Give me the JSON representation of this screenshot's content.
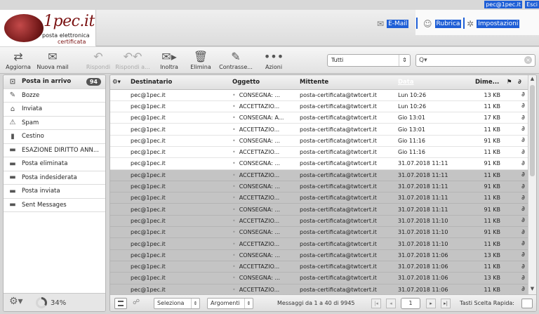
{
  "topbar": {
    "user": "pec@1pec.it",
    "logout": "Esci"
  },
  "brand": {
    "name": "1pec.it",
    "tagline1": "posta elettronica",
    "tagline2": "certificata"
  },
  "nav": {
    "mail": "E-Mail",
    "rubrica": "Rubrica",
    "settings": "Impostazioni"
  },
  "toolbar": {
    "refresh": "Aggiorna",
    "new_mail": "Nuova mail",
    "reply": "Rispondi",
    "reply_all": "Rispondi a...",
    "forward": "Inoltra",
    "delete": "Elimina",
    "mark": "Contrasse...",
    "actions": "Azioni",
    "filter_value": "Tutti",
    "search_placeholder": "Q▾"
  },
  "sidebar": {
    "items": [
      {
        "label": "Posta in arrivo",
        "icon": "inbox-icon",
        "count": "94",
        "active": true
      },
      {
        "label": "Bozze",
        "icon": "pencil-icon"
      },
      {
        "label": "Inviata",
        "icon": "sent-icon"
      },
      {
        "label": "Spam",
        "icon": "spam-icon"
      },
      {
        "label": "Cestino",
        "icon": "trash-icon"
      },
      {
        "label": "ESAZIONE DIRITTO ANN...",
        "icon": "folder-icon"
      },
      {
        "label": "Posta eliminata",
        "icon": "folder-icon"
      },
      {
        "label": "Posta indesiderata",
        "icon": "folder-icon"
      },
      {
        "label": "Posta inviata",
        "icon": "folder-icon"
      },
      {
        "label": "Sent Messages",
        "icon": "folder-icon"
      }
    ],
    "quota": "34%",
    "quota_value": 34
  },
  "list": {
    "headers": {
      "to": "Destinatario",
      "subject": "Oggetto",
      "from": "Mittente",
      "date": "Data",
      "size": "Dime..."
    },
    "rows": [
      {
        "to": "pec@1pec.it",
        "subject": "CONSEGNA: ...",
        "from": "posta-certificata@twtcert.it",
        "date": "Lun 10:26",
        "size": "13 KB",
        "selected": false
      },
      {
        "to": "pec@1pec.it",
        "subject": "ACCETTAZIO...",
        "from": "posta-certificata@twtcert.it",
        "date": "Lun 10:26",
        "size": "11 KB",
        "selected": false
      },
      {
        "to": "pec@1pec.it",
        "subject": "CONSEGNA: A...",
        "from": "posta-certificata@twtcert.it",
        "date": "Gio 13:01",
        "size": "17 KB",
        "selected": false
      },
      {
        "to": "pec@1pec.it",
        "subject": "ACCETTAZIO...",
        "from": "posta-certificata@twtcert.it",
        "date": "Gio 13:01",
        "size": "11 KB",
        "selected": false
      },
      {
        "to": "pec@1pec.it",
        "subject": "CONSEGNA: ...",
        "from": "posta-certificata@twtcert.it",
        "date": "Gio 11:16",
        "size": "91 KB",
        "selected": false
      },
      {
        "to": "pec@1pec.it",
        "subject": "ACCETTAZIO...",
        "from": "posta-certificata@twtcert.it",
        "date": "Gio 11:16",
        "size": "11 KB",
        "selected": false
      },
      {
        "to": "pec@1pec.it",
        "subject": "CONSEGNA: ...",
        "from": "posta-certificata@twtcert.it",
        "date": "31.07.2018 11:11",
        "size": "91 KB",
        "selected": false
      },
      {
        "to": "pec@1pec.it",
        "subject": "ACCETTAZIO...",
        "from": "posta-certificata@twtcert.it",
        "date": "31.07.2018 11:11",
        "size": "11 KB",
        "selected": true
      },
      {
        "to": "pec@1pec.it",
        "subject": "CONSEGNA: ...",
        "from": "posta-certificata@twtcert.it",
        "date": "31.07.2018 11:11",
        "size": "91 KB",
        "selected": true
      },
      {
        "to": "pec@1pec.it",
        "subject": "ACCETTAZIO...",
        "from": "posta-certificata@twtcert.it",
        "date": "31.07.2018 11:11",
        "size": "11 KB",
        "selected": true
      },
      {
        "to": "pec@1pec.it",
        "subject": "CONSEGNA: ...",
        "from": "posta-certificata@twtcert.it",
        "date": "31.07.2018 11:11",
        "size": "91 KB",
        "selected": true
      },
      {
        "to": "pec@1pec.it",
        "subject": "ACCETTAZIO...",
        "from": "posta-certificata@twtcert.it",
        "date": "31.07.2018 11:10",
        "size": "11 KB",
        "selected": true
      },
      {
        "to": "pec@1pec.it",
        "subject": "CONSEGNA: ...",
        "from": "posta-certificata@twtcert.it",
        "date": "31.07.2018 11:10",
        "size": "91 KB",
        "selected": true
      },
      {
        "to": "pec@1pec.it",
        "subject": "ACCETTAZIO...",
        "from": "posta-certificata@twtcert.it",
        "date": "31.07.2018 11:10",
        "size": "11 KB",
        "selected": true
      },
      {
        "to": "pec@1pec.it",
        "subject": "CONSEGNA: ...",
        "from": "posta-certificata@twtcert.it",
        "date": "31.07.2018 11:06",
        "size": "13 KB",
        "selected": true
      },
      {
        "to": "pec@1pec.it",
        "subject": "ACCETTAZIO...",
        "from": "posta-certificata@twtcert.it",
        "date": "31.07.2018 11:06",
        "size": "11 KB",
        "selected": true
      },
      {
        "to": "pec@1pec.it",
        "subject": "CONSEGNA: ...",
        "from": "posta-certificata@twtcert.it",
        "date": "31.07.2018 11:06",
        "size": "13 KB",
        "selected": true
      },
      {
        "to": "pec@1pec.it",
        "subject": "ACCETTAZIO...",
        "from": "posta-certificata@twtcert.it",
        "date": "31.07.2018 11:06",
        "size": "11 KB",
        "selected": true
      }
    ]
  },
  "footer": {
    "select_label": "Seleziona",
    "threads_label": "Argomenti",
    "status": "Messaggi da 1 a 40 di 9945",
    "page": "1",
    "shortcuts": "Tasti Scelta Rapida:"
  },
  "colors": {
    "accent": "#1f5fd6",
    "brand": "#7a1111",
    "selected_row": "#c4c4c4"
  }
}
